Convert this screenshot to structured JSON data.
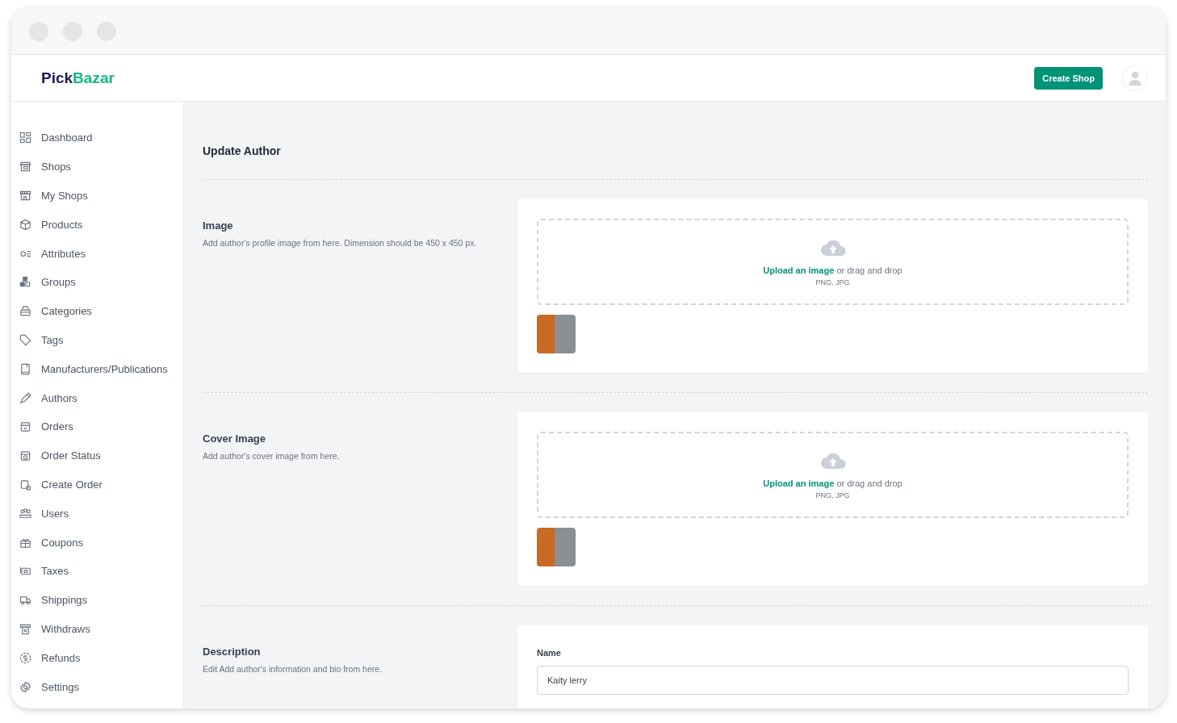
{
  "header": {
    "logo_first": "Pick",
    "logo_second": "Bazar",
    "create_button": "Create Shop"
  },
  "sidebar": {
    "items": [
      {
        "label": "Dashboard"
      },
      {
        "label": "Shops"
      },
      {
        "label": "My Shops"
      },
      {
        "label": "Products"
      },
      {
        "label": "Attributes"
      },
      {
        "label": "Groups"
      },
      {
        "label": "Categories"
      },
      {
        "label": "Tags"
      },
      {
        "label": "Manufacturers/Publications"
      },
      {
        "label": "Authors"
      },
      {
        "label": "Orders"
      },
      {
        "label": "Order Status"
      },
      {
        "label": "Create Order"
      },
      {
        "label": "Users"
      },
      {
        "label": "Coupons"
      },
      {
        "label": "Taxes"
      },
      {
        "label": "Shippings"
      },
      {
        "label": "Withdraws"
      },
      {
        "label": "Refunds"
      },
      {
        "label": "Settings"
      }
    ]
  },
  "page_title": "Update Author",
  "sections": [
    {
      "kind": "upload",
      "title": "Image",
      "description": "Add author's profile image from here. Dimension should be 450 x 450 px.",
      "upload_link": "Upload an image",
      "upload_rest": "or drag and drop",
      "formats": "PNG, JPG"
    },
    {
      "kind": "upload",
      "title": "Cover Image",
      "description": "Add author's cover image from here.",
      "upload_link": "Upload an image",
      "upload_rest": "or drag and drop",
      "formats": "PNG, JPG"
    },
    {
      "kind": "form",
      "title": "Description",
      "description": "Edit Add author's information and bio from here.",
      "field_label": "Name",
      "field_value": "Kaity lerry"
    }
  ]
}
